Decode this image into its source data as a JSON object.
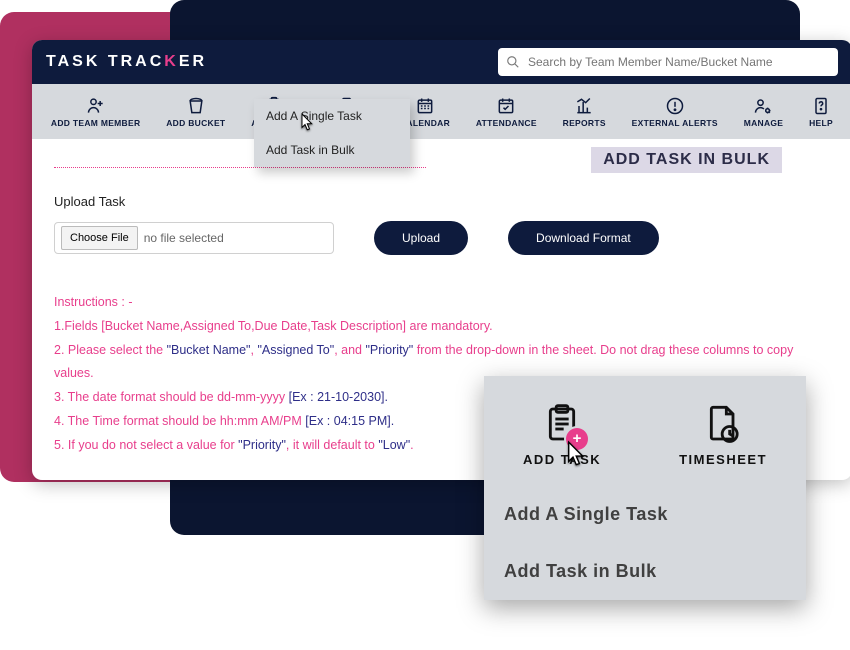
{
  "brand": {
    "task": "TASK",
    "tracker": "TRAC",
    "pinkletter": "K",
    "trackerend": "ER"
  },
  "search": {
    "placeholder": "Search by Team Member Name/Bucket Name"
  },
  "toolbar": [
    {
      "name": "add-team-member",
      "label": "ADD TEAM MEMBER",
      "icon": "person-plus"
    },
    {
      "name": "add-bucket",
      "label": "ADD BUCKET",
      "icon": "bucket"
    },
    {
      "name": "add-task",
      "label": "ADD TASK",
      "icon": "clipboard-plus"
    },
    {
      "name": "timesheet",
      "label": "TIMESHEET",
      "icon": "file-clock"
    },
    {
      "name": "calendar",
      "label": "CALENDAR",
      "icon": "calendar"
    },
    {
      "name": "attendance",
      "label": "ATTENDANCE",
      "icon": "calendar-check"
    },
    {
      "name": "reports",
      "label": "REPORTS",
      "icon": "chart"
    },
    {
      "name": "external-alerts",
      "label": "EXTERNAL ALERTS",
      "icon": "alert"
    },
    {
      "name": "manage",
      "label": "MANAGE",
      "icon": "person-gear"
    },
    {
      "name": "help",
      "label": "HELP",
      "icon": "help-book"
    }
  ],
  "dropdown": {
    "opt1": "Add A Single Task",
    "opt2": "Add Task in Bulk"
  },
  "page": {
    "title": "ADD TASK IN BULK"
  },
  "upload": {
    "section": "Upload Task",
    "choose": "Choose File",
    "nofile": "no file selected",
    "uploadBtn": "Upload",
    "downloadBtn": "Download Format"
  },
  "instructions": {
    "hdr": "Instructions : -",
    "l1a": "1.Fields [Bucket Name,Assigned To,Due Date,Task Description] are mandatory.",
    "l2a": "2. Please select the ",
    "l2b": "\"Bucket Name\"",
    "l2c": ", ",
    "l2d": "\"Assigned To\"",
    "l2e": ", and ",
    "l2f": "\"Priority\"",
    "l2g": " from the drop-down in the sheet. Do not drag these columns to copy values.",
    "l3a": "3. The date format should be dd-mm-yyyy ",
    "l3b": "[Ex : 21-10-2030].",
    "l4a": "4. The Time format should be hh:mm AM/PM ",
    "l4b": "[Ex : 04:15 PM].",
    "l5a": "5. If you do not select a value for ",
    "l5b": "\"Priority\"",
    "l5c": ", it will default to ",
    "l5d": "\"Low\"",
    "l5e": "."
  },
  "zoom": {
    "addtask": "ADD TASK",
    "timesheet": "TIMESHEET",
    "opt1": "Add A Single Task",
    "opt2": "Add Task in Bulk"
  }
}
